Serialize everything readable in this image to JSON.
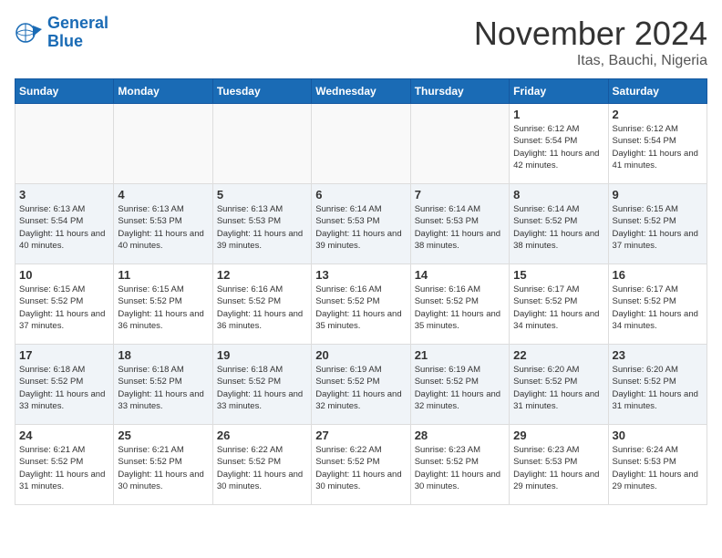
{
  "logo": {
    "line1": "General",
    "line2": "Blue"
  },
  "title": "November 2024",
  "location": "Itas, Bauchi, Nigeria",
  "days_of_week": [
    "Sunday",
    "Monday",
    "Tuesday",
    "Wednesday",
    "Thursday",
    "Friday",
    "Saturday"
  ],
  "weeks": [
    [
      {
        "day": "",
        "info": ""
      },
      {
        "day": "",
        "info": ""
      },
      {
        "day": "",
        "info": ""
      },
      {
        "day": "",
        "info": ""
      },
      {
        "day": "",
        "info": ""
      },
      {
        "day": "1",
        "info": "Sunrise: 6:12 AM\nSunset: 5:54 PM\nDaylight: 11 hours and 42 minutes."
      },
      {
        "day": "2",
        "info": "Sunrise: 6:12 AM\nSunset: 5:54 PM\nDaylight: 11 hours and 41 minutes."
      }
    ],
    [
      {
        "day": "3",
        "info": "Sunrise: 6:13 AM\nSunset: 5:54 PM\nDaylight: 11 hours and 40 minutes."
      },
      {
        "day": "4",
        "info": "Sunrise: 6:13 AM\nSunset: 5:53 PM\nDaylight: 11 hours and 40 minutes."
      },
      {
        "day": "5",
        "info": "Sunrise: 6:13 AM\nSunset: 5:53 PM\nDaylight: 11 hours and 39 minutes."
      },
      {
        "day": "6",
        "info": "Sunrise: 6:14 AM\nSunset: 5:53 PM\nDaylight: 11 hours and 39 minutes."
      },
      {
        "day": "7",
        "info": "Sunrise: 6:14 AM\nSunset: 5:53 PM\nDaylight: 11 hours and 38 minutes."
      },
      {
        "day": "8",
        "info": "Sunrise: 6:14 AM\nSunset: 5:52 PM\nDaylight: 11 hours and 38 minutes."
      },
      {
        "day": "9",
        "info": "Sunrise: 6:15 AM\nSunset: 5:52 PM\nDaylight: 11 hours and 37 minutes."
      }
    ],
    [
      {
        "day": "10",
        "info": "Sunrise: 6:15 AM\nSunset: 5:52 PM\nDaylight: 11 hours and 37 minutes."
      },
      {
        "day": "11",
        "info": "Sunrise: 6:15 AM\nSunset: 5:52 PM\nDaylight: 11 hours and 36 minutes."
      },
      {
        "day": "12",
        "info": "Sunrise: 6:16 AM\nSunset: 5:52 PM\nDaylight: 11 hours and 36 minutes."
      },
      {
        "day": "13",
        "info": "Sunrise: 6:16 AM\nSunset: 5:52 PM\nDaylight: 11 hours and 35 minutes."
      },
      {
        "day": "14",
        "info": "Sunrise: 6:16 AM\nSunset: 5:52 PM\nDaylight: 11 hours and 35 minutes."
      },
      {
        "day": "15",
        "info": "Sunrise: 6:17 AM\nSunset: 5:52 PM\nDaylight: 11 hours and 34 minutes."
      },
      {
        "day": "16",
        "info": "Sunrise: 6:17 AM\nSunset: 5:52 PM\nDaylight: 11 hours and 34 minutes."
      }
    ],
    [
      {
        "day": "17",
        "info": "Sunrise: 6:18 AM\nSunset: 5:52 PM\nDaylight: 11 hours and 33 minutes."
      },
      {
        "day": "18",
        "info": "Sunrise: 6:18 AM\nSunset: 5:52 PM\nDaylight: 11 hours and 33 minutes."
      },
      {
        "day": "19",
        "info": "Sunrise: 6:18 AM\nSunset: 5:52 PM\nDaylight: 11 hours and 33 minutes."
      },
      {
        "day": "20",
        "info": "Sunrise: 6:19 AM\nSunset: 5:52 PM\nDaylight: 11 hours and 32 minutes."
      },
      {
        "day": "21",
        "info": "Sunrise: 6:19 AM\nSunset: 5:52 PM\nDaylight: 11 hours and 32 minutes."
      },
      {
        "day": "22",
        "info": "Sunrise: 6:20 AM\nSunset: 5:52 PM\nDaylight: 11 hours and 31 minutes."
      },
      {
        "day": "23",
        "info": "Sunrise: 6:20 AM\nSunset: 5:52 PM\nDaylight: 11 hours and 31 minutes."
      }
    ],
    [
      {
        "day": "24",
        "info": "Sunrise: 6:21 AM\nSunset: 5:52 PM\nDaylight: 11 hours and 31 minutes."
      },
      {
        "day": "25",
        "info": "Sunrise: 6:21 AM\nSunset: 5:52 PM\nDaylight: 11 hours and 30 minutes."
      },
      {
        "day": "26",
        "info": "Sunrise: 6:22 AM\nSunset: 5:52 PM\nDaylight: 11 hours and 30 minutes."
      },
      {
        "day": "27",
        "info": "Sunrise: 6:22 AM\nSunset: 5:52 PM\nDaylight: 11 hours and 30 minutes."
      },
      {
        "day": "28",
        "info": "Sunrise: 6:23 AM\nSunset: 5:52 PM\nDaylight: 11 hours and 30 minutes."
      },
      {
        "day": "29",
        "info": "Sunrise: 6:23 AM\nSunset: 5:53 PM\nDaylight: 11 hours and 29 minutes."
      },
      {
        "day": "30",
        "info": "Sunrise: 6:24 AM\nSunset: 5:53 PM\nDaylight: 11 hours and 29 minutes."
      }
    ]
  ]
}
